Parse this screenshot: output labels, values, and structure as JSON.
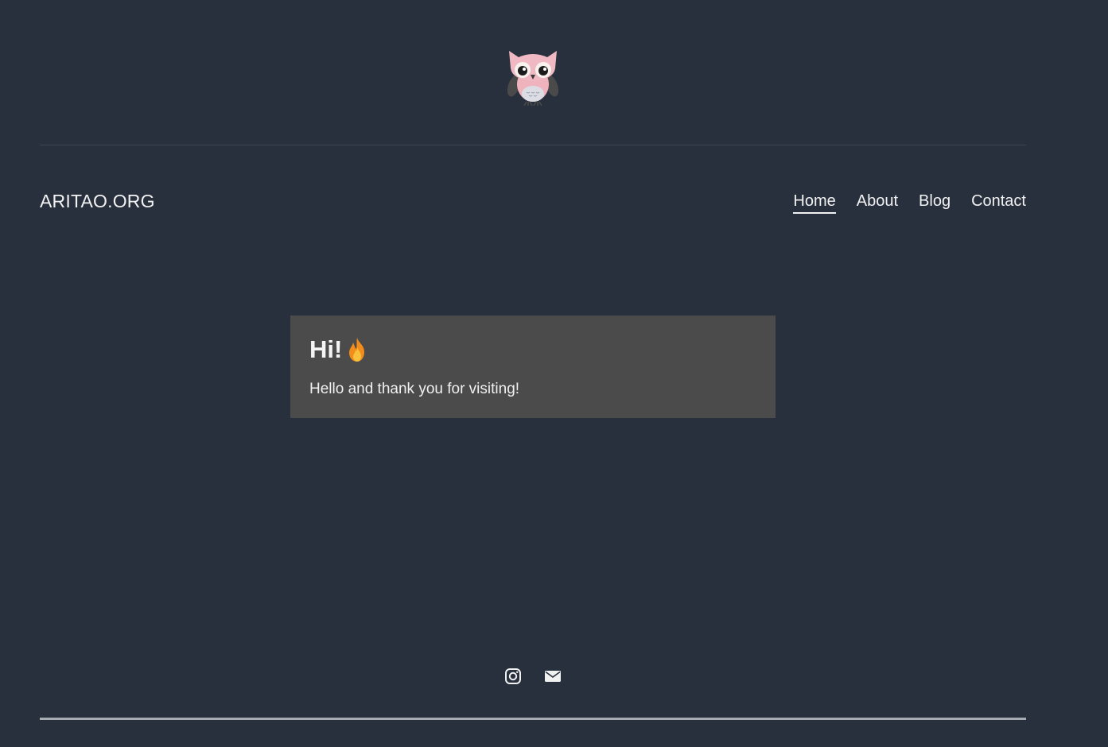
{
  "site": {
    "title": "ARITAO.ORG",
    "logo_icon": "owl-logo-icon"
  },
  "nav": {
    "items": [
      {
        "label": "Home",
        "active": true
      },
      {
        "label": "About",
        "active": false
      },
      {
        "label": "Blog",
        "active": false
      },
      {
        "label": "Contact",
        "active": false
      }
    ]
  },
  "card": {
    "heading": "Hi!",
    "heading_icon": "fire-emoji-icon",
    "text": "Hello and thank you for visiting!"
  },
  "footer": {
    "social_icons": [
      "instagram-icon",
      "email-icon"
    ]
  },
  "colors": {
    "background": "#28303d",
    "card_background": "#4b4b4b",
    "text": "#f1f1f1",
    "bottom_rule": "#a7acb3"
  }
}
